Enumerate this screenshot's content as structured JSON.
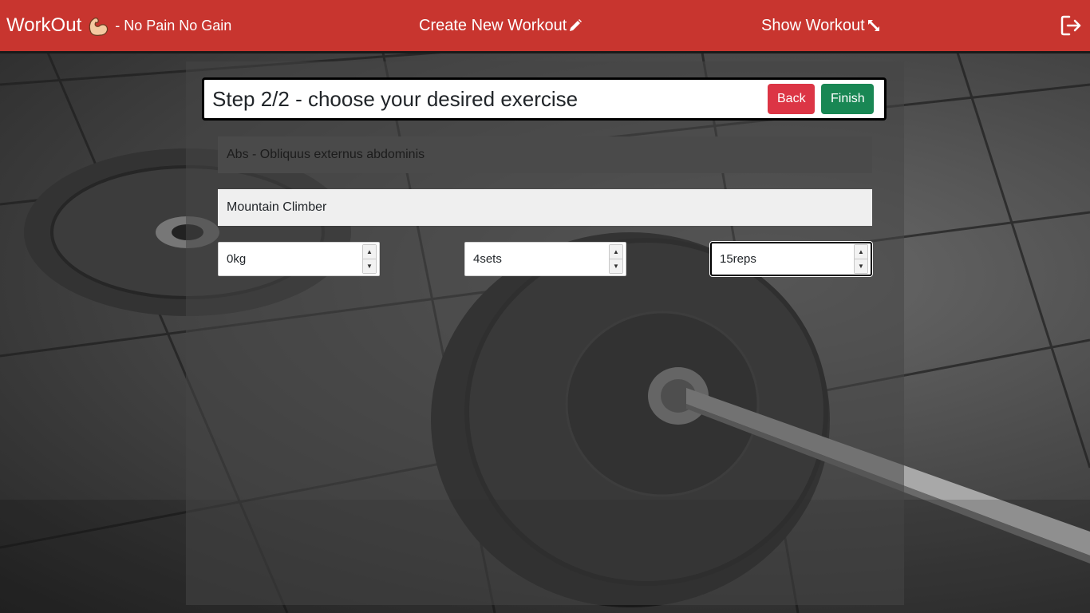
{
  "navbar": {
    "brand_title": "WorkOut",
    "brand_icon": "flexed-arm-icon",
    "brand_subtitle": "- No Pain No Gain",
    "create_link": "Create New Workout",
    "create_icon": "pencil-icon",
    "show_link": "Show Workout",
    "show_icon": "expand-arrows-icon",
    "logout_icon": "logout-icon",
    "bg_color": "#c8352f"
  },
  "step": {
    "title": "Step 2/2 - choose your desired exercise",
    "back_label": "Back",
    "finish_label": "Finish"
  },
  "selections": {
    "muscle": "Abs - Obliquus externus abdominis",
    "exercise": "Mountain Climber"
  },
  "fields": {
    "weight": "0kg",
    "sets": "4sets",
    "reps": "15reps"
  },
  "colors": {
    "back_button": "#dc3545",
    "finish_button": "#198754"
  }
}
